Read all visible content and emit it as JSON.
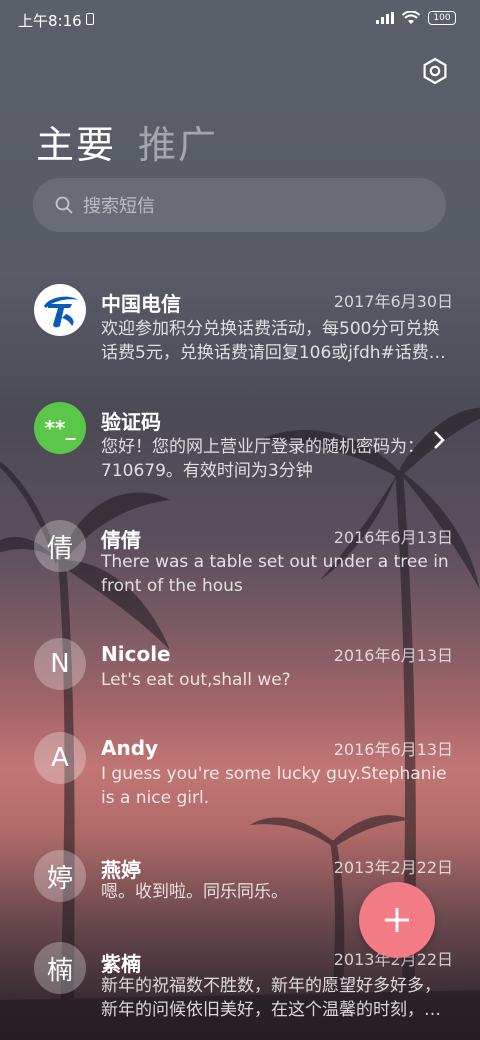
{
  "status_bar": {
    "time": "上午8:16",
    "battery": "100"
  },
  "tabs": [
    {
      "label": "主要",
      "active": true
    },
    {
      "label": "推广",
      "active": false
    }
  ],
  "search": {
    "placeholder": "搜索短信"
  },
  "conversations": [
    {
      "name": "中国电信",
      "date": "2017年6月30日",
      "preview": "欢迎参加积分兑换话费活动，每500分可兑换话费5元，兑换话费请回复106或jfdh#话费…",
      "avatar_type": "logo",
      "avatar_icon": "china-telecom-logo-icon"
    },
    {
      "name": "验证码",
      "date": "",
      "preview": "您好！您的网上营业厅登录的随机密码为：710679。有效时间为3分钟",
      "avatar_type": "icon",
      "avatar_text": "**_",
      "avatar_color": "#5cc64a"
    },
    {
      "name": "倩倩",
      "date": "2016年6月13日",
      "preview": "There was a table set out under a tree in front of the hous",
      "avatar_text": "倩"
    },
    {
      "name": "Nicole",
      "date": "2016年6月13日",
      "preview": "Let's eat out,shall we?",
      "avatar_text": "N"
    },
    {
      "name": "Andy",
      "date": "2016年6月13日",
      "preview": "I guess you're some lucky guy.Stephanie is a nice girl.",
      "avatar_text": "A"
    },
    {
      "name": "燕婷",
      "date": "2013年2月22日",
      "preview": "嗯。收到啦。同乐同乐。",
      "avatar_text": "婷"
    },
    {
      "name": "紫楠",
      "date": "2013年2月22日",
      "preview": "新年的祝福数不胜数，新年的愿望好多好多，新年的问候依旧美好，在这个温馨的时刻，…",
      "avatar_text": "楠"
    }
  ],
  "colors": {
    "fab": "#f27b85",
    "verify_avatar": "#5cc64a",
    "telecom_blue": "#0a5bb5"
  }
}
